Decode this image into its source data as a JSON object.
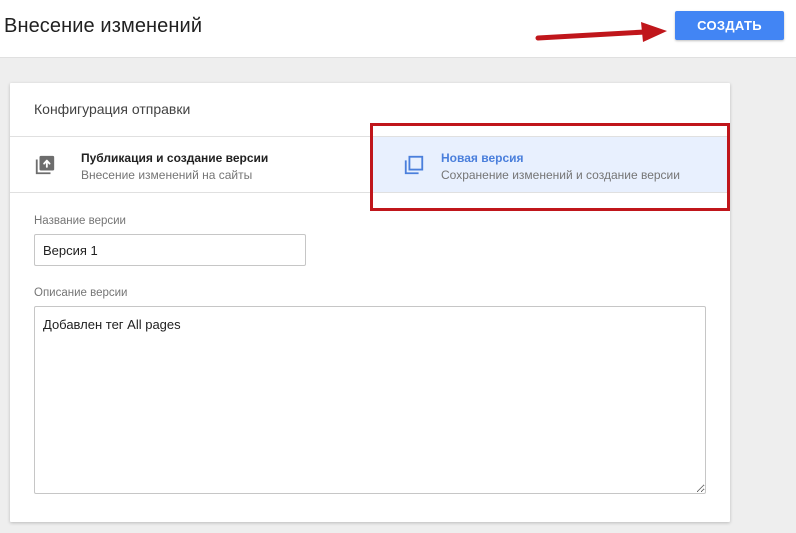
{
  "header": {
    "title": "Внесение изменений",
    "create_button_label": "СОЗДАТЬ"
  },
  "card": {
    "title": "Конфигурация отправки",
    "options": [
      {
        "title": "Публикация и создание версии",
        "subtitle": "Внесение изменений на сайты",
        "icon": "publish-icon",
        "selected": false
      },
      {
        "title": "Новая версия",
        "subtitle": "Сохранение изменений и создание версии",
        "icon": "new-version-icon",
        "selected": true
      }
    ],
    "version_name": {
      "label": "Название версии",
      "value": "Версия 1"
    },
    "version_description": {
      "label": "Описание версии",
      "value": "Добавлен тег All pages"
    }
  },
  "colors": {
    "accent": "#4285f4",
    "selected_bg": "#e8f0fe",
    "annotation_red": "#c0161b"
  }
}
